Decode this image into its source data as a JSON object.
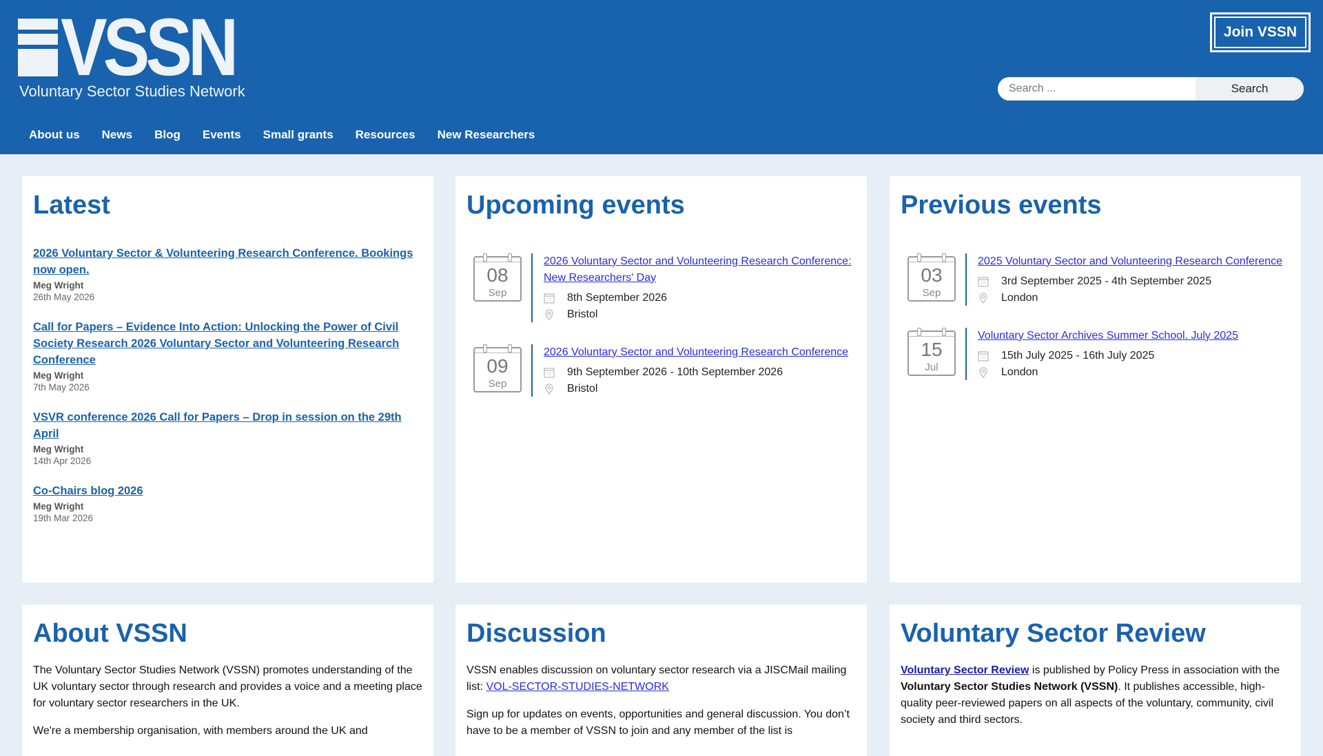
{
  "site": {
    "logo_text": "VSSN",
    "logo_subtitle": "Voluntary Sector Studies Network",
    "join_label": "Join VSSN",
    "search_placeholder": "Search ...",
    "search_button": "Search"
  },
  "nav": [
    "About us",
    "News",
    "Blog",
    "Events",
    "Small grants",
    "Resources",
    "New Researchers"
  ],
  "latest": {
    "heading": "Latest",
    "posts": [
      {
        "title": "2026 Voluntary Sector & Volunteering Research Conference. Bookings now open.",
        "author": "Meg Wright",
        "date": "26th May 2026"
      },
      {
        "title": "Call for Papers – Evidence Into Action: Unlocking the Power of Civil Society Research 2026 Voluntary Sector and Volunteering Research Conference",
        "author": "Meg Wright",
        "date": "7th May 2026"
      },
      {
        "title": "VSVR conference 2026 Call for Papers – Drop in session on the 29th April",
        "author": "Meg Wright",
        "date": "14th Apr 2026"
      },
      {
        "title": "Co-Chairs blog 2026",
        "author": "Meg Wright",
        "date": "19th Mar 2026"
      }
    ]
  },
  "upcoming": {
    "heading": "Upcoming events",
    "events": [
      {
        "day": "08",
        "month": "Sep",
        "title": "2026 Voluntary Sector and Volunteering Research Conference: New Researchers' Day",
        "dates": "8th September 2026",
        "location": "Bristol"
      },
      {
        "day": "09",
        "month": "Sep",
        "title": "2026 Voluntary Sector and Volunteering Research Conference",
        "dates": "9th September 2026 - 10th September 2026",
        "location": "Bristol"
      }
    ]
  },
  "previous": {
    "heading": "Previous events",
    "events": [
      {
        "day": "03",
        "month": "Sep",
        "title": "2025 Voluntary Sector and Volunteering Research Conference",
        "dates": "3rd September 2025 - 4th September 2025",
        "location": "London"
      },
      {
        "day": "15",
        "month": "Jul",
        "title": "Voluntary Sector Archives Summer School. July 2025",
        "dates": "15th July 2025 - 16th July 2025",
        "location": "London"
      }
    ]
  },
  "about": {
    "heading": "About VSSN",
    "p1": "The Voluntary Sector Studies Network (VSSN) promotes understanding of the UK voluntary sector through research and provides a voice and a meeting place for voluntary sector researchers in the UK.",
    "p2": "We're a membership organisation, with members around the UK and"
  },
  "discussion": {
    "heading": "Discussion",
    "p1_text": "VSSN enables discussion on voluntary sector research via a JISCMail mailing list: ",
    "p1_link": "VOL-SECTOR-STUDIES-NETWORK",
    "p2": "Sign up for updates on events, opportunities and general discussion. You don’t have to be a member of VSSN to join and any member of the list is"
  },
  "vsr": {
    "heading": "Voluntary Sector Review",
    "link": "Voluntary Sector Review",
    "text_a": " is published by Policy Press in association with the ",
    "bold": "Voluntary Sector Studies Network (VSSN)",
    "text_b": ". It publishes accessible, high-quality peer-reviewed papers on all aspects of the voluntary, community, civil society and third sectors."
  },
  "colors": {
    "brand": "#1962ad",
    "background": "#e8eef6",
    "link": "#2a2ae8"
  }
}
